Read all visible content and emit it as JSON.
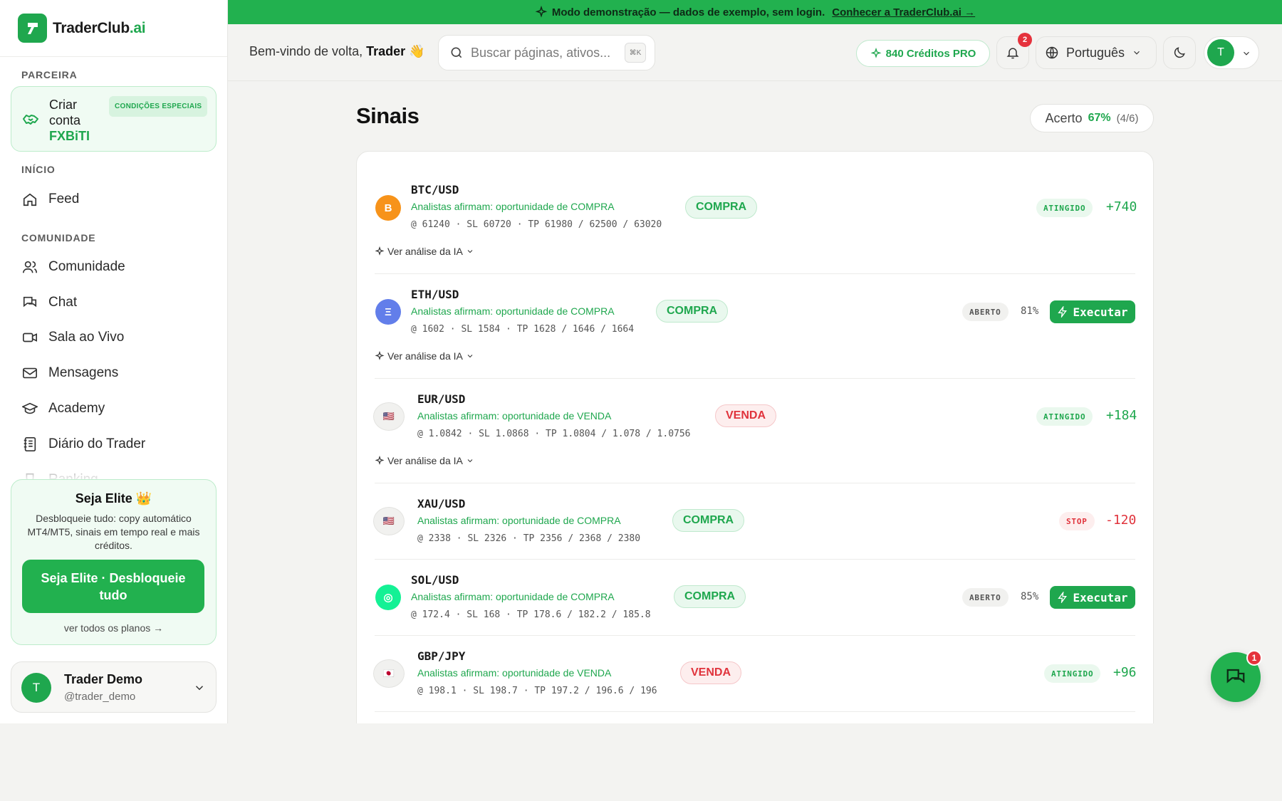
{
  "brand": {
    "name": "TraderClub",
    "suffix": ".ai"
  },
  "banner": {
    "text": "Modo demonstração — dados de exemplo, sem login.",
    "link": "Conhecer a TraderClub.ai →"
  },
  "sidebar": {
    "partner_label": "PARCEIRA",
    "partner_text_1": "Criar",
    "partner_text_2": "conta",
    "partner_highlight": "FXBiTI",
    "partner_tag": "CONDIÇÕES ESPECIAIS",
    "inicio_label": "INÍCIO",
    "feed": "Feed",
    "comunidade_label": "COMUNIDADE",
    "items": [
      "Comunidade",
      "Chat",
      "Sala ao Vivo",
      "Mensagens",
      "Academy",
      "Diário do Trader",
      "Ranking"
    ],
    "elite": {
      "title": "Seja Elite 👑",
      "desc": "Desbloqueie tudo: copy automático MT4/MT5, sinais em tempo real e mais créditos.",
      "cta": "Seja Elite · Desbloqueie tudo",
      "plans": "ver todos os planos →"
    },
    "user": {
      "initial": "T",
      "name": "Trader Demo",
      "handle": "@trader_demo"
    }
  },
  "header": {
    "welcome": "Bem-vindo de volta,",
    "welcome_name": "Trader 👋",
    "search_placeholder": "Buscar páginas, ativos...",
    "search_kbd": "⌘K",
    "credits": "840 Créditos PRO",
    "notif_count": "2",
    "language": "Português",
    "user_initial": "T"
  },
  "main": {
    "title": "Sinais",
    "accuracy_label": "Acerto",
    "accuracy_pct": "67%",
    "accuracy_count": "(4/6)",
    "ai_label": "Ver análise da IA"
  },
  "signals": [
    {
      "pair": "BTC/USD",
      "icon": "B",
      "icon_color": "#f7931a",
      "desc": "Analistas afirmam: oportunidade de COMPRA",
      "levels": "@ 61240 · SL 60720 · TP 61980 / 62500 / 63020",
      "side": "COMPRA",
      "status": "ATINGIDO",
      "result": "+740"
    },
    {
      "pair": "ETH/USD",
      "icon": "Ξ",
      "icon_color": "#627eea",
      "desc": "Analistas afirmam: oportunidade de COMPRA",
      "levels": "@ 1602 · SL 1584 · TP 1628 / 1646 / 1664",
      "side": "COMPRA",
      "status": "ABERTO",
      "confidence": "81%",
      "exec": "Executar"
    },
    {
      "pair": "EUR/USD",
      "icon": "🇺🇸",
      "desc": "Analistas afirmam: oportunidade de VENDA",
      "levels": "@ 1.0842 · SL 1.0868 · TP 1.0804 / 1.078 / 1.0756",
      "side": "VENDA",
      "status": "ATINGIDO",
      "result": "+184"
    },
    {
      "pair": "XAU/USD",
      "icon": "🇺🇸",
      "desc": "Analistas afirmam: oportunidade de COMPRA",
      "levels": "@ 2338 · SL 2326 · TP 2356 / 2368 / 2380",
      "side": "COMPRA",
      "status": "STOP",
      "result": "-120"
    },
    {
      "pair": "SOL/USD",
      "icon": "◎",
      "icon_color": "#14f195",
      "desc": "Analistas afirmam: oportunidade de COMPRA",
      "levels": "@ 172.4 · SL 168 · TP 178.6 / 182.2 / 185.8",
      "side": "COMPRA",
      "status": "ABERTO",
      "confidence": "85%",
      "exec": "Executar"
    },
    {
      "pair": "GBP/JPY",
      "icon": "🇯🇵",
      "desc": "Analistas afirmam: oportunidade de VENDA",
      "levels": "@ 198.1 · SL 198.7 · TP 197.2 / 196.6 / 196",
      "side": "VENDA",
      "status": "ATINGIDO",
      "result": "+96"
    }
  ],
  "chat_badge": "1",
  "colors": {
    "accent": "#22b14f",
    "sell": "#e0333c",
    "btc": "#f7931a",
    "eth": "#627eea",
    "sol": "#14f195"
  }
}
